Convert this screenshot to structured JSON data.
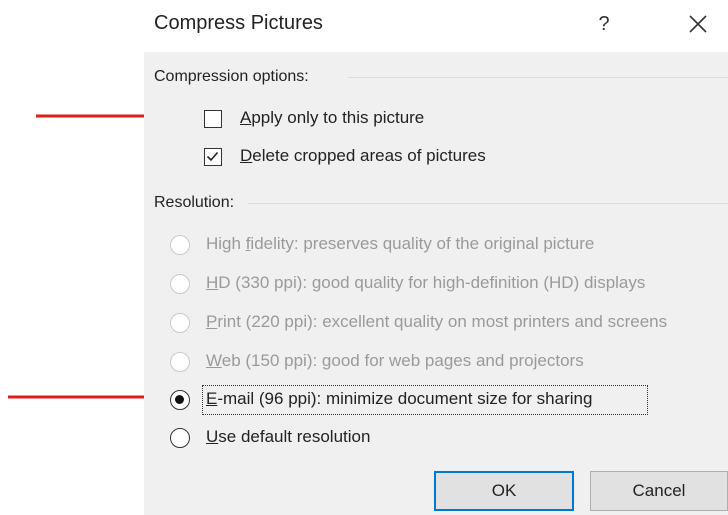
{
  "dialog": {
    "title": "Compress Pictures",
    "help_label": "?",
    "close_icon": "close-icon"
  },
  "compression": {
    "group_label": "Compression options:",
    "options": [
      {
        "prefix": "",
        "accel": "A",
        "rest": "pply only to this picture",
        "checked": false
      },
      {
        "prefix": "",
        "accel": "D",
        "rest": "elete cropped areas of pictures",
        "checked": true
      }
    ]
  },
  "resolution": {
    "group_label": "Resolution:",
    "options": [
      {
        "prefix": "High ",
        "accel": "f",
        "rest": "idelity: preserves quality of the original picture",
        "enabled": false,
        "selected": false
      },
      {
        "prefix": "",
        "accel": "H",
        "rest": "D (330 ppi): good quality for high-definition (HD) displays",
        "enabled": false,
        "selected": false
      },
      {
        "prefix": "",
        "accel": "P",
        "rest": "rint (220 ppi): excellent quality on most printers and screens",
        "enabled": false,
        "selected": false
      },
      {
        "prefix": "",
        "accel": "W",
        "rest": "eb (150 ppi): good for web pages and projectors",
        "enabled": false,
        "selected": false
      },
      {
        "prefix": "",
        "accel": "E",
        "rest": "-mail (96 ppi): minimize document size for sharing",
        "enabled": true,
        "selected": true
      },
      {
        "prefix": "",
        "accel": "U",
        "rest": "se default resolution",
        "enabled": true,
        "selected": false
      }
    ]
  },
  "buttons": {
    "ok_label": "OK",
    "cancel_label": "Cancel"
  },
  "annotations": {
    "arrow_color": "#e01b1b"
  }
}
